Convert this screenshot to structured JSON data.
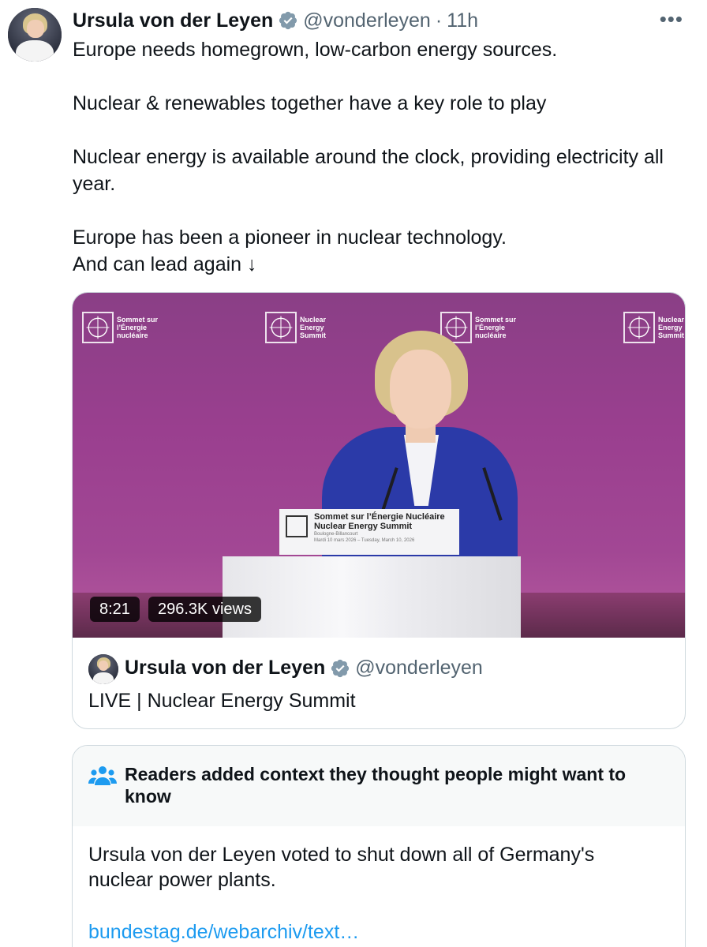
{
  "tweet": {
    "author_name": "Ursula von der Leyen",
    "handle": "@vonderleyen",
    "separator": "·",
    "time": "11h",
    "more_label": "•••",
    "verified_icon": "verified-badge-icon",
    "lines": [
      "Europe needs homegrown, low-carbon energy sources.",
      "Nuclear & renewables together have a key role to play",
      "Nuclear energy is available around the clock, providing electricity all year.",
      "Europe has been a pioneer in nuclear technology.",
      "And can lead again ↓"
    ]
  },
  "video": {
    "duration": "8:21",
    "views": "296.3K views",
    "backdrop_logos": [
      "Sommet sur l’Énergie nucléaire",
      "Nuclear Energy Summit",
      "Sommet sur l’Énergie nucléaire",
      "Nuclear Energy Summit"
    ],
    "lectern_line1": "Sommet sur l’Énergie Nucléaire",
    "lectern_line2": "Nuclear Energy Summit",
    "lectern_line3": "Boulogne-Billancourt",
    "lectern_line4": "Mardi 10 mars 2026 – Tuesday, March 10, 2026"
  },
  "card": {
    "author_name": "Ursula von der Leyen",
    "handle": "@vonderleyen",
    "title": "LIVE | Nuclear Energy Summit"
  },
  "community_note": {
    "heading": "Readers added context they thought people might want to know",
    "body": "Ursula von der Leyen voted to shut down all of Germany's nuclear power plants.",
    "link": "bundestag.de/webarchiv/text…",
    "icon": "people-icon"
  },
  "colors": {
    "text": "#0f1419",
    "secondary": "#536471",
    "link": "#1d9bf0",
    "verified": "#829aab",
    "border": "#cfd9de"
  }
}
